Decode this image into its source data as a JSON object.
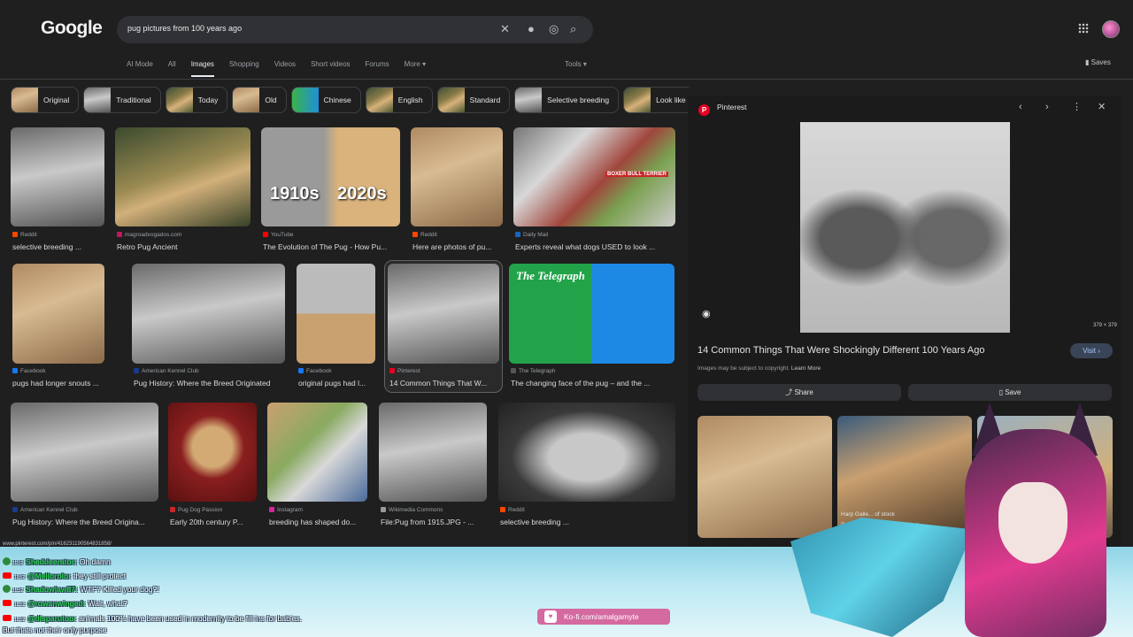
{
  "header": {
    "logo": "Google",
    "query": "pug pictures from 100 years ago",
    "saves": "Saves"
  },
  "tabs": [
    "AI Mode",
    "All",
    "Images",
    "Shopping",
    "Videos",
    "Short videos",
    "Forums",
    "More ▾"
  ],
  "tools": "Tools ▾",
  "chips": [
    "Original",
    "Traditional",
    "Today",
    "Old",
    "Chinese",
    "English",
    "Standard",
    "Selective breeding",
    "Look like"
  ],
  "results": [
    {
      "source": "Reddit",
      "title": "selective breeding ..."
    },
    {
      "source": "magroadvogados.com",
      "title": "Retro Pug Ancient"
    },
    {
      "source": "YouTube",
      "title": "The Evolution of The Pug - How Pu...",
      "overlay_left": "1910s",
      "overlay_right": "2020s"
    },
    {
      "source": "Reddit",
      "title": "Here are photos of pu..."
    },
    {
      "source": "Daily Mail",
      "title": "Experts reveal what dogs USED to look ...",
      "overlay": "BOXER BULL TERRIER"
    },
    {
      "source": "Facebook",
      "title": "pugs had longer snouts ..."
    },
    {
      "source": "American Kennel Club",
      "title": "Pug History: Where the Breed Originated"
    },
    {
      "source": "Facebook",
      "title": "original pugs had l..."
    },
    {
      "source": "Pinterest",
      "title": "14 Common Things That W..."
    },
    {
      "source": "The Telegraph",
      "title": "The changing face of the pug – and the ...",
      "overlay": "The Telegraph"
    },
    {
      "source": "American Kennel Club",
      "title": "Pug History: Where the Breed Origina..."
    },
    {
      "source": "Pug Dog Passion",
      "title": "Early 20th century P..."
    },
    {
      "source": "Instagram",
      "title": "breeding has shaped do..."
    },
    {
      "source": "Wikimedia Commons",
      "title": "File:Pug from 1915.JPG - ..."
    },
    {
      "source": "Reddit",
      "title": "selective breeding ..."
    }
  ],
  "panel": {
    "source": "Pinterest",
    "dimensions": "379 × 379",
    "title": "14 Common Things That Were Shockingly Different 100 Years Ago",
    "visit": "Visit",
    "note": "Images may be subject to copyright.",
    "learn_more": "Learn More",
    "share": "Share",
    "save": "Save",
    "related_caption_1": "Harp Galle... of stock",
    "related_caption_2": "Pug Dog A... ent Antique Prints..."
  },
  "status_url": "www.pinterest.com/pin/416231190564831858/",
  "chat": [
    {
      "name": "Sheddeerator:",
      "text": "Oh damn",
      "youtube": false
    },
    {
      "name": "@Mellorolo:",
      "text": "they still protect",
      "youtube": true
    },
    {
      "name": "Shadowlaw87:",
      "text": "WTF? Killed your dog?!",
      "youtube": false
    },
    {
      "name": "@rowanwinged:",
      "text": "Wait, what?",
      "youtube": true
    },
    {
      "name": "@disparutoo:",
      "text": "animals 100% have been used in modernity to be fill ins for babies.",
      "youtube": true
    },
    {
      "name": "",
      "text": "But thats not their only purpose",
      "youtube": false
    }
  ],
  "chat_time": "11:52",
  "kofi": "Ko-fi.com/amalgamyte",
  "colors": {
    "background": "#1f1f1f",
    "accent": "#a8c7fa",
    "pinterest": "#e60023",
    "kofi": "#d46aa0"
  }
}
